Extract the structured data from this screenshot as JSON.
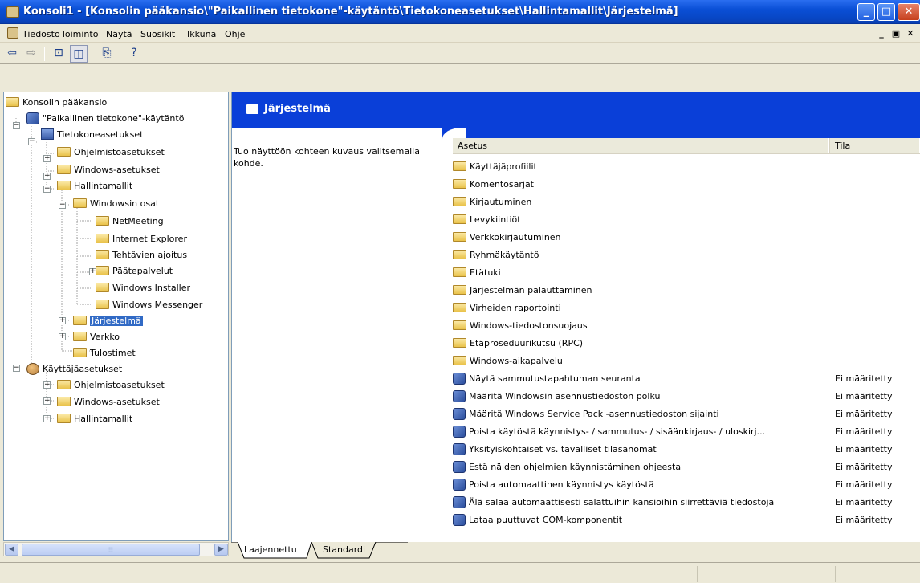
{
  "window": {
    "title": "Konsoli1 - [Konsolin pääkansio\\\"Paikallinen tietokone\"-käytäntö\\Tietokoneasetukset\\Hallintamallit\\Järjestelmä]"
  },
  "menu": {
    "items": [
      "Tiedosto",
      "Toiminto",
      "Näytä",
      "Suosikit",
      "Ikkuna",
      "Ohje"
    ]
  },
  "tree": {
    "root": "Konsolin pääkansio",
    "policy": "\"Paikallinen tietokone\"-käytäntö",
    "computer": "Tietokoneasetukset",
    "c_software": "Ohjelmistoasetukset",
    "c_windows": "Windows-asetukset",
    "c_admin": "Hallintamallit",
    "win_components": "Windowsin osat",
    "netmeeting": "NetMeeting",
    "ie": "Internet Explorer",
    "scheduler": "Tehtävien ajoitus",
    "terminal": "Päätepalvelut",
    "installer": "Windows Installer",
    "messenger": "Windows Messenger",
    "system": "Järjestelmä",
    "network": "Verkko",
    "printers": "Tulostimet",
    "user": "Käyttäjäasetukset",
    "u_software": "Ohjelmistoasetukset",
    "u_windows": "Windows-asetukset",
    "u_admin": "Hallintamallit"
  },
  "header": {
    "title": "Järjestelmä"
  },
  "description": "Tuo näyttöön kohteen kuvaus valitsemalla kohde.",
  "listview": {
    "columns": [
      "Asetus",
      "Tila"
    ],
    "folders": [
      "Käyttäjäprofiilit",
      "Komentosarjat",
      "Kirjautuminen",
      "Levykiintiöt",
      "Verkkokirjautuminen",
      "Ryhmäkäytäntö",
      "Etätuki",
      "Järjestelmän palauttaminen",
      "Virheiden raportointi",
      "Windows-tiedostonsuojaus",
      "Etäproseduurikutsu (RPC)",
      "Windows-aikapalvelu"
    ],
    "settings": [
      {
        "name": "Näytä sammutustapahtuman seuranta",
        "state": "Ei määritetty"
      },
      {
        "name": "Määritä Windowsin asennustiedoston polku",
        "state": "Ei määritetty"
      },
      {
        "name": "Määritä Windows Service Pack -asennustiedoston sijainti",
        "state": "Ei määritetty"
      },
      {
        "name": "Poista käytöstä käynnistys- / sammutus- / sisäänkirjaus- / uloskirj...",
        "state": "Ei määritetty"
      },
      {
        "name": "Yksityiskohtaiset vs. tavalliset tilasanomat",
        "state": "Ei määritetty"
      },
      {
        "name": "Estä näiden ohjelmien käynnistäminen ohjeesta",
        "state": "Ei määritetty"
      },
      {
        "name": "Poista automaattinen käynnistys käytöstä",
        "state": "Ei määritetty"
      },
      {
        "name": "Älä salaa automaattisesti salattuihin kansioihin siirrettäviä tiedostoja",
        "state": "Ei määritetty"
      },
      {
        "name": "Lataa puuttuvat COM-komponentit",
        "state": "Ei määritetty"
      }
    ]
  },
  "tabs": [
    "Laajennettu",
    "Standardi"
  ],
  "colors": {
    "header_blue": "#0a3fd8",
    "selection": "#316ac5"
  }
}
